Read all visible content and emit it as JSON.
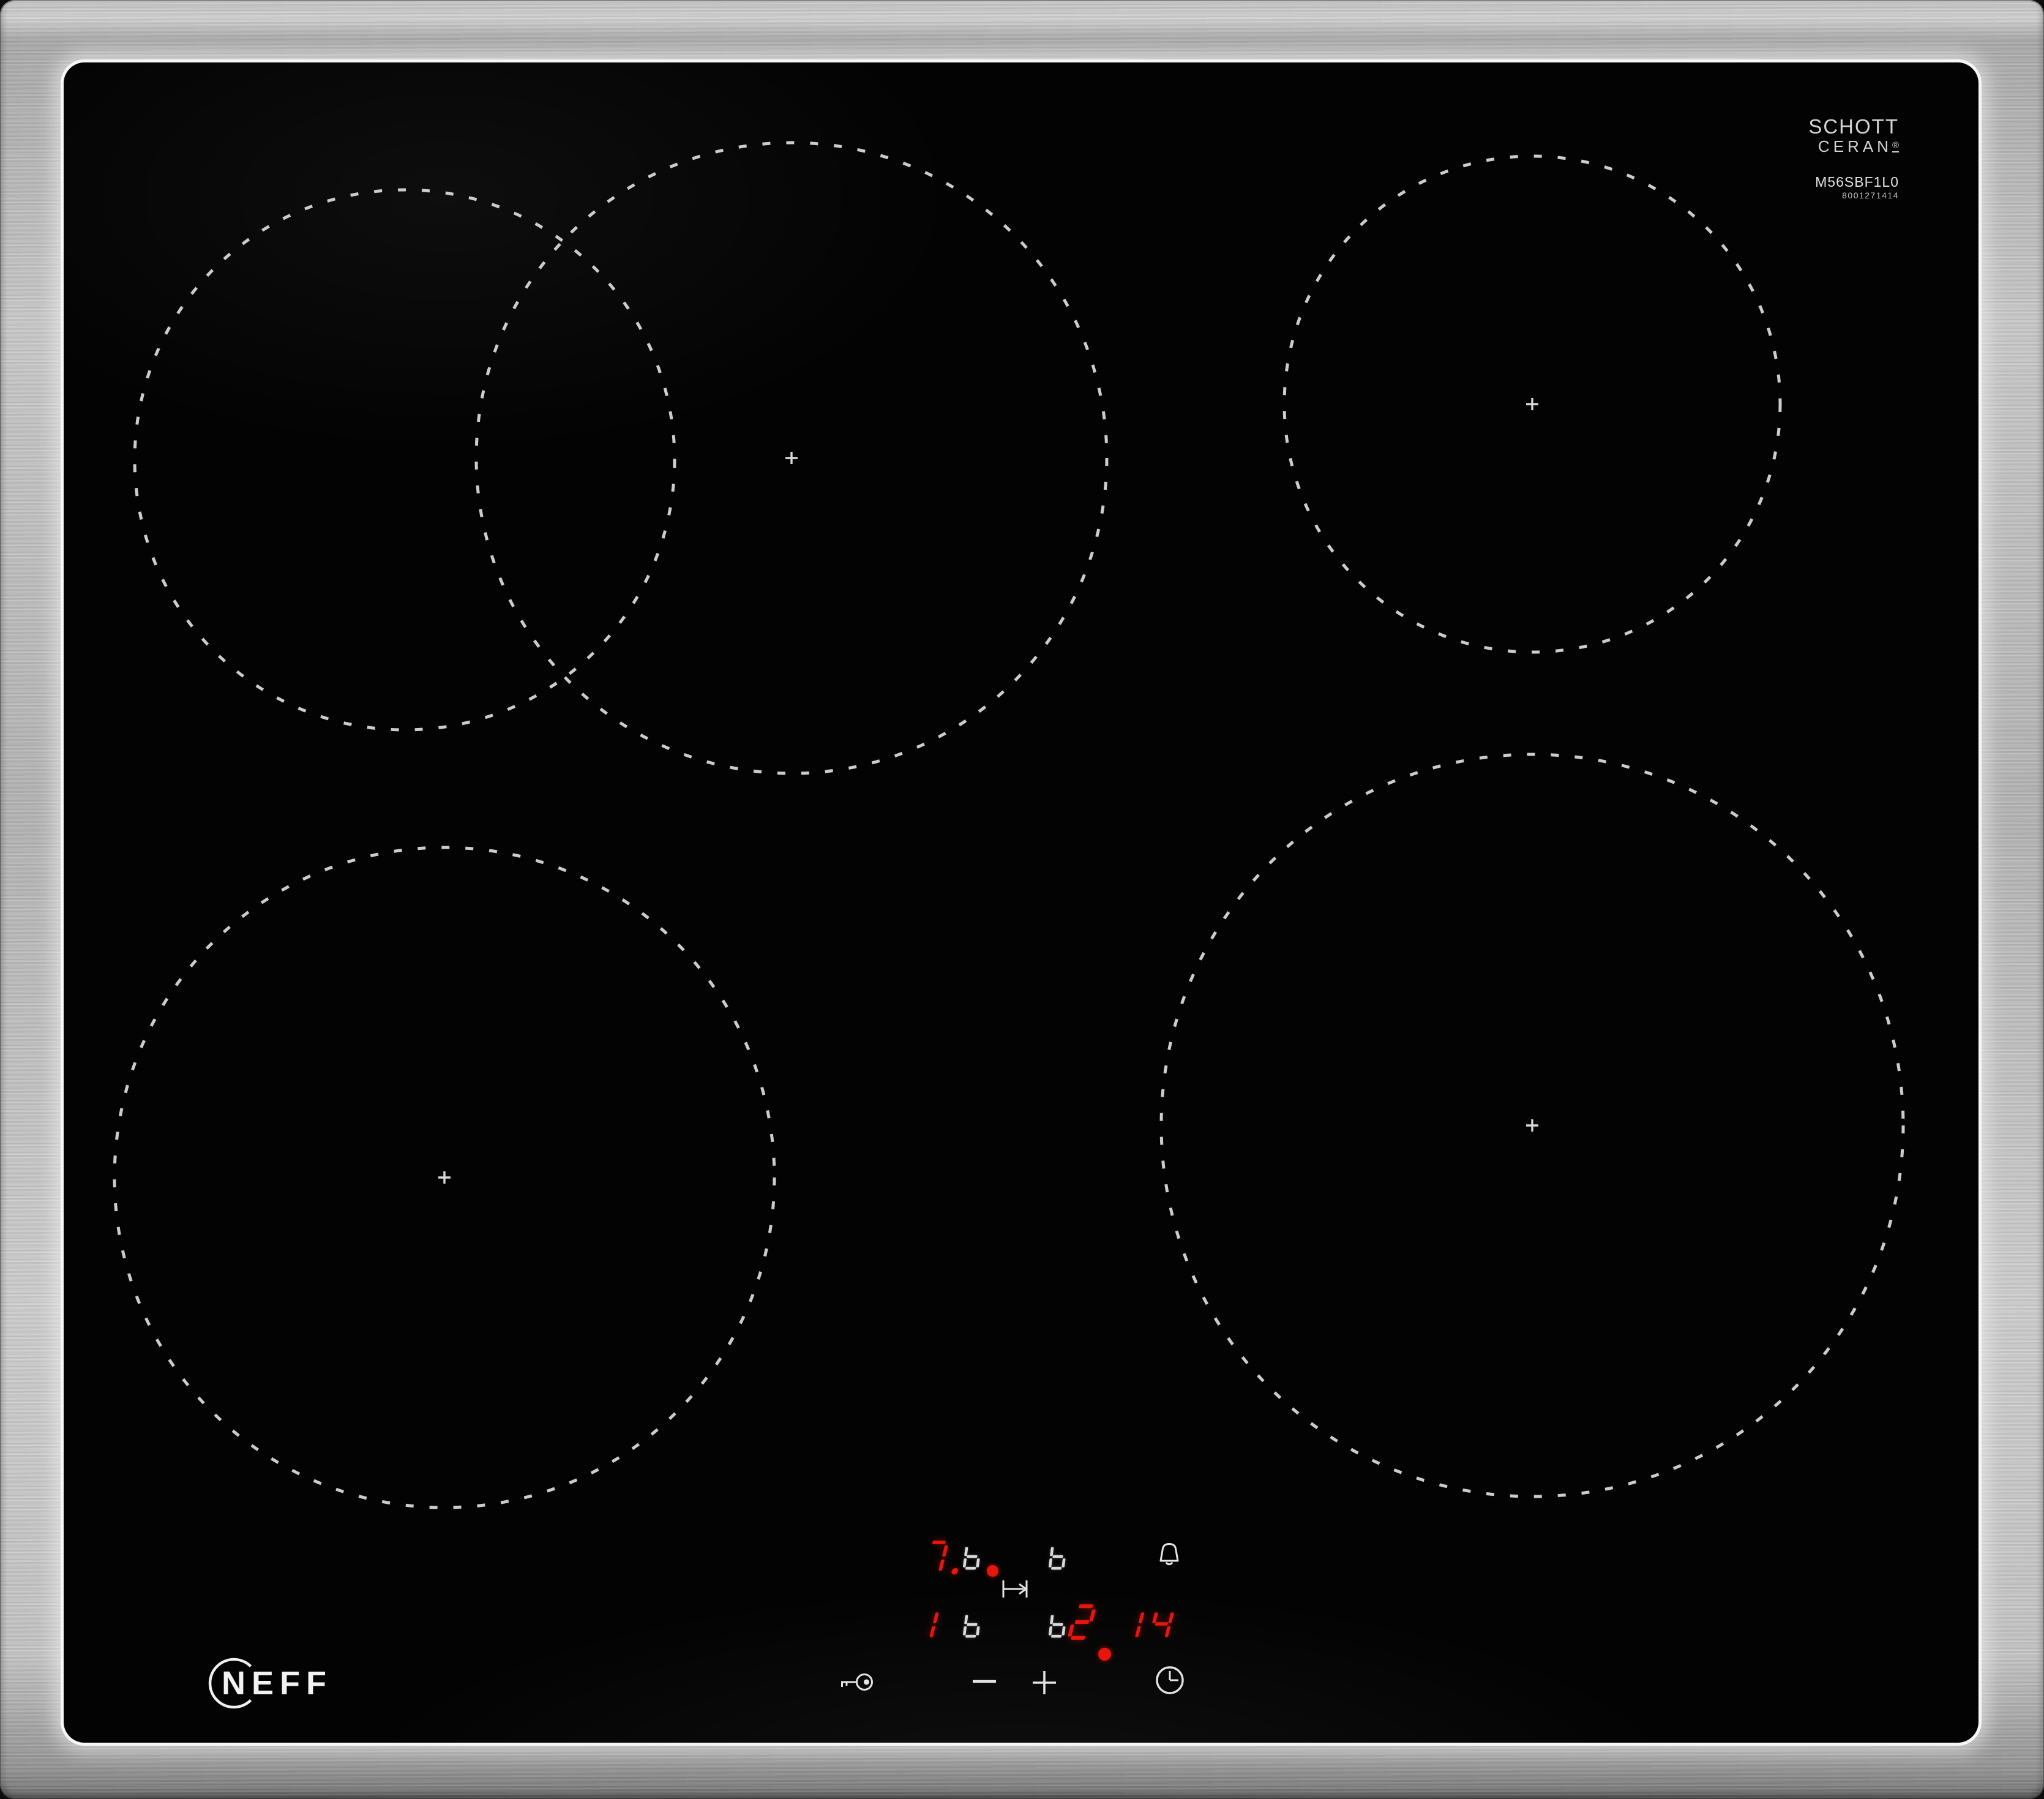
{
  "branding": {
    "neff_logo_text": "NEFF",
    "glass_brand_line1": "SCHOTT",
    "glass_brand_line2": "CERAN",
    "glass_brand_reg": "®",
    "model_number": "M56SBF1L0",
    "product_code": "8001271414"
  },
  "display": {
    "back_left": {
      "level": "7.",
      "aux": "b"
    },
    "back_right": {
      "aux": "b"
    },
    "front_left": {
      "level": "1",
      "aux": "b"
    },
    "front_right": {
      "level": "2",
      "aux": "b"
    },
    "timer_minutes": "14"
  },
  "controls": {
    "key_lock_label": "child lock",
    "minus_label": "−",
    "plus_label": "+",
    "timer_clock_label": "timer",
    "alarm_bell_label": "alarm",
    "bridge_zone_label": "bridge zone"
  },
  "icons": {
    "alarm": "bell-icon",
    "timer": "clock-icon",
    "child_lock": "key-icon",
    "bridge": "arrow-to-bar-icon",
    "zone_marker": "plus-cross"
  },
  "colors": {
    "led_red": "#e8150c",
    "led_white": "#d9d9d9",
    "glass_black": "#030303",
    "steel_light": "#d6d6d6"
  }
}
